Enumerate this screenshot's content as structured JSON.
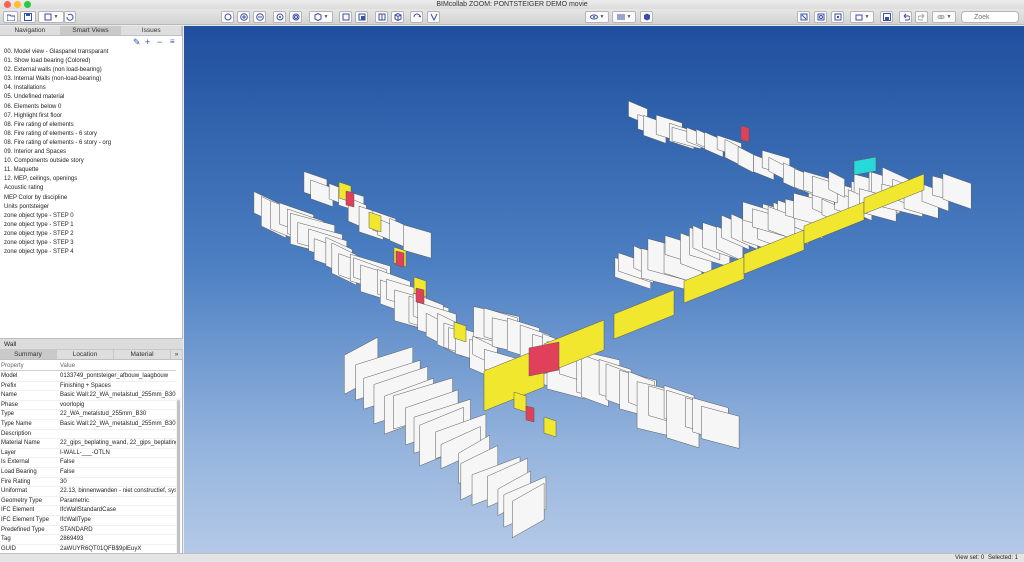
{
  "window": {
    "title": "BIMcollab ZOOM: PONTSTEIGER DEMO movie"
  },
  "toolbar": {
    "search_placeholder": "Zoek"
  },
  "left_tabs": [
    "Navigation",
    "Smart Views",
    "Issues"
  ],
  "smart_views": [
    "00. Model view - Glaspanel transparant",
    "01. Show load bearing (Colored)",
    "02. External walls (non load-bearing)",
    "03. Internal Walls (non-load-bearing)",
    "04. Installations",
    "05. Undefined material",
    "06. Elements below 0",
    "07. Highlight first floor",
    "08. Fire rating of elements",
    "08. Fire rating of elements - 6 story",
    "08. Fire rating of elements - 6 story - org",
    "09. Interior and Spaces",
    "10. Components outside story",
    "11. Maquette",
    "12. MEP, ceilings, openings",
    "Acoustic rating",
    "MEP Color by discipline",
    "Units pontsteiger",
    "zone object type - STEP 0",
    "zone object type - STEP 1",
    "zone object type - STEP 2",
    "zone object type - STEP 3",
    "zone object type - STEP 4"
  ],
  "properties_panel": {
    "title": "Wall",
    "tabs": [
      "Summary",
      "Location",
      "Material"
    ],
    "more": "»",
    "col_property": "Property",
    "col_value": "Value",
    "rows": [
      {
        "k": "Model",
        "v": "0133749_pontsteiger_afbouw_laagbouw"
      },
      {
        "k": "Prefix",
        "v": "Finishing + Spaces"
      },
      {
        "k": "Name",
        "v": "Basic Wall:22_WA_metalstud_255mm_B30:2"
      },
      {
        "k": "Phase",
        "v": "voorlopig"
      },
      {
        "k": "Type",
        "v": "22_WA_metalstud_255mm_B30"
      },
      {
        "k": "Type Name",
        "v": "Basic Wall:22_WA_metalstud_255mm_B30"
      },
      {
        "k": "Description",
        "v": ""
      },
      {
        "k": "Material Name",
        "v": "22_gips_beplating_wand, 22_gips_beplating,"
      },
      {
        "k": "Layer",
        "v": "I-WALL-___-OTLN"
      },
      {
        "k": "Is External",
        "v": "False"
      },
      {
        "k": "Load Bearing",
        "v": "False"
      },
      {
        "k": "Fire Rating",
        "v": "30"
      },
      {
        "k": "Uniformat",
        "v": "22.13, binnenwanden - niet constructief, sys"
      },
      {
        "k": "Geometry Type",
        "v": "Parametric"
      },
      {
        "k": "IFC Element",
        "v": "IfcWallStandardCase"
      },
      {
        "k": "IFC Element Type",
        "v": "IfcWallType"
      },
      {
        "k": "Predefined Type",
        "v": "STANDARD"
      },
      {
        "k": "Tag",
        "v": "2869493"
      },
      {
        "k": "GUID",
        "v": "2aWUYR6QT01QFB$9plEuyX"
      }
    ]
  },
  "status": {
    "view_set": "View set: 0",
    "selected": "Selected: 1"
  },
  "colors": {
    "highlight_yellow": "#f1e72e",
    "highlight_red": "#e0405a",
    "highlight_cyan": "#29d8d8",
    "wall_white": "#f6f6f6",
    "accent_blue": "#3b4ea8"
  }
}
